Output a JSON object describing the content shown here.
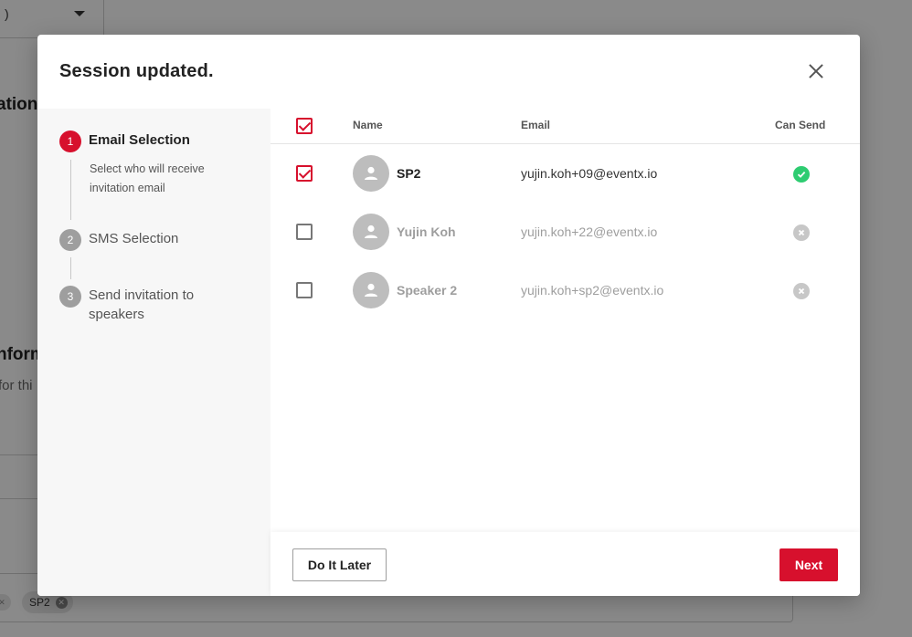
{
  "background": {
    "select_value": ")",
    "heading_partial": "ation",
    "section_partial": "nform",
    "sub_partial": "for thi",
    "tag_label": "SP2"
  },
  "modal": {
    "title": "Session updated.",
    "close_icon": "close-icon"
  },
  "stepper": {
    "steps": [
      {
        "number": "1",
        "label": "Email Selection",
        "description": "Select who will receive invitation email",
        "active": true
      },
      {
        "number": "2",
        "label": "SMS Selection",
        "active": false
      },
      {
        "number": "3",
        "label": "Send invitation to speakers",
        "active": false
      }
    ]
  },
  "table": {
    "headers": {
      "name": "Name",
      "email": "Email",
      "can_send": "Can Send"
    },
    "select_all_checked": true,
    "rows": [
      {
        "name": "SP2",
        "email": "yujin.koh+09@eventx.io",
        "checked": true,
        "can_send": true
      },
      {
        "name": "Yujin Koh",
        "email": "yujin.koh+22@eventx.io",
        "checked": false,
        "can_send": false
      },
      {
        "name": "Speaker 2",
        "email": "yujin.koh+sp2@eventx.io",
        "checked": false,
        "can_send": false
      }
    ]
  },
  "footer": {
    "later_label": "Do It Later",
    "next_label": "Next"
  },
  "colors": {
    "accent": "#d7102d",
    "success": "#2ecc71",
    "disabled": "#c7c7c7"
  }
}
